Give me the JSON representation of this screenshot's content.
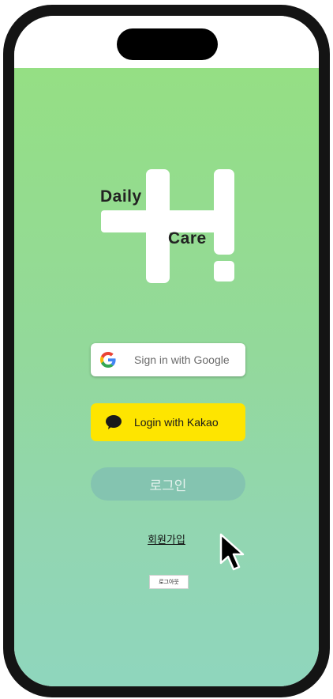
{
  "logo": {
    "word_top": "Daily",
    "word_bottom": "Care"
  },
  "auth": {
    "google_label": "Sign in with Google",
    "kakao_label": "Login with Kakao",
    "login_label": "로그인",
    "signup_label": "회원가입",
    "logout_label": "로그아웃"
  },
  "colors": {
    "background_top": "#95df84",
    "background_bottom": "#8fd6bd",
    "kakao_yellow": "#fee500",
    "login_button": "#84c4b0"
  },
  "icons": {
    "google": "google-g-icon",
    "kakao": "kakao-speech-bubble-icon",
    "cursor": "mouse-pointer-icon"
  }
}
